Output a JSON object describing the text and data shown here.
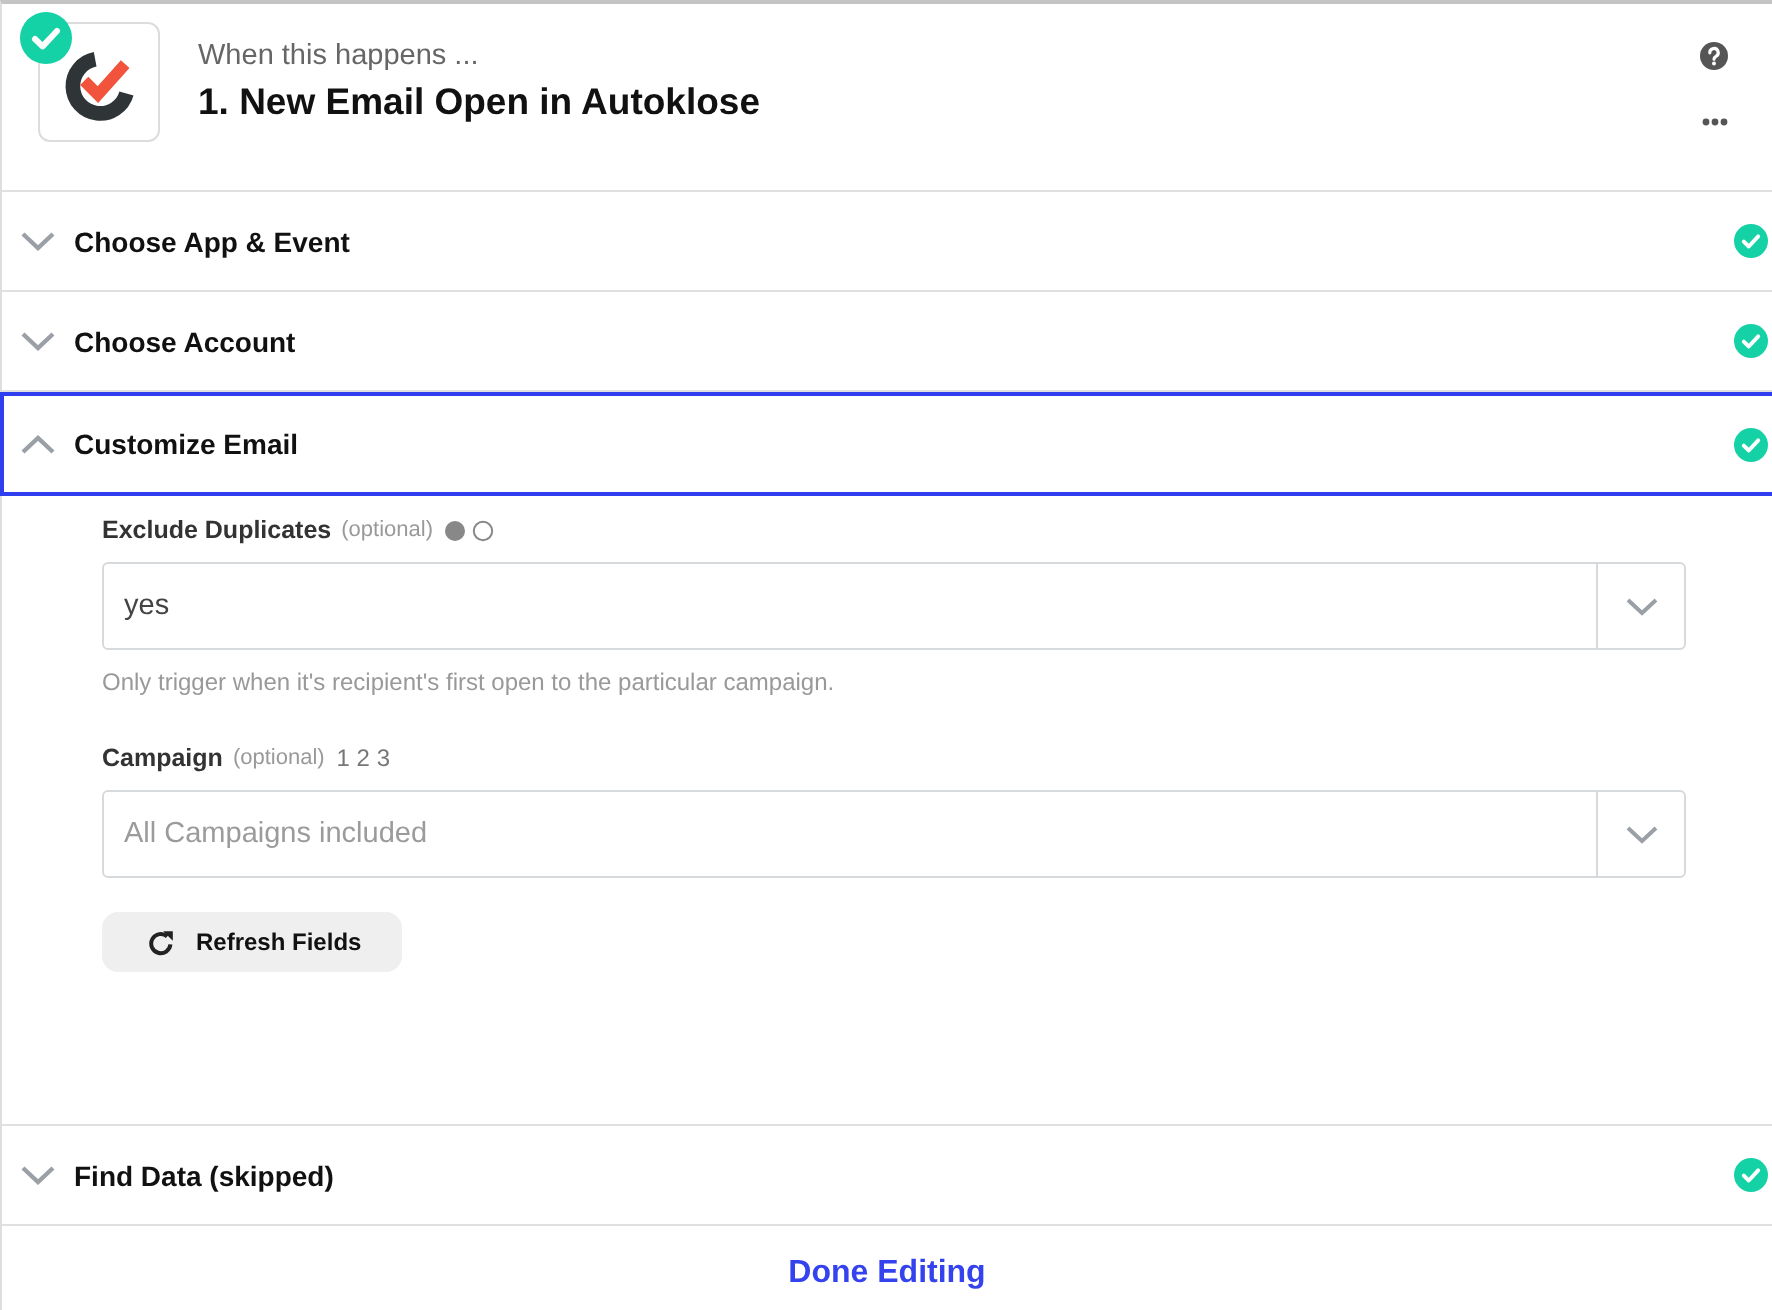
{
  "trigger": {
    "complete": true,
    "subtitle": "When this happens ...",
    "title": "1. New Email Open in Autoklose"
  },
  "sections": [
    {
      "title": "Choose App & Event",
      "expanded": false,
      "complete": true
    },
    {
      "title": "Choose Account",
      "expanded": false,
      "complete": true
    },
    {
      "title": "Customize Email",
      "expanded": true,
      "complete": true,
      "fields": [
        {
          "kind": "boolean",
          "label": "Exclude Duplicates",
          "optional": "(optional)",
          "value": "yes",
          "help": "Only trigger when it's recipient's first open to the particular campaign."
        },
        {
          "kind": "number",
          "label": "Campaign",
          "optional": "(optional)",
          "type_hint": "1 2 3",
          "placeholder": "All Campaigns included"
        }
      ],
      "action_button": "Refresh Fields"
    },
    {
      "title": "Find Data (skipped)",
      "expanded": false,
      "complete": true
    }
  ],
  "footer": {
    "done_button": "Done Editing"
  }
}
